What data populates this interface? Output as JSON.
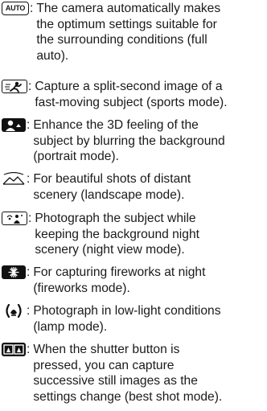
{
  "modes": [
    {
      "icon": "auto-mode-icon",
      "icon_text": "AUTO",
      "lines": [
        "The camera automatically makes",
        "the optimum settings suitable for",
        "the surrounding conditions (full",
        "auto)."
      ]
    },
    {
      "icon": "sports-mode-icon",
      "lines": [
        "Capture a split-second image of a",
        "fast-moving subject (sports mode)."
      ]
    },
    {
      "icon": "portrait-mode-icon",
      "lines": [
        "Enhance the 3D feeling of the",
        "subject by blurring the background",
        "(portrait mode)."
      ]
    },
    {
      "icon": "landscape-mode-icon",
      "lines": [
        "For beautiful shots of distant",
        "scenery (landscape mode)."
      ]
    },
    {
      "icon": "night-view-mode-icon",
      "lines": [
        "Photograph the subject while",
        "keeping the background night",
        "scenery (night view mode)."
      ]
    },
    {
      "icon": "fireworks-mode-icon",
      "lines": [
        "For capturing fireworks at night",
        "(fireworks mode)."
      ]
    },
    {
      "icon": "lamp-mode-icon",
      "lines": [
        "Photograph in low-light conditions",
        "(lamp mode)."
      ]
    },
    {
      "icon": "best-shot-mode-icon",
      "lines": [
        "When the shutter button is",
        "pressed, you can capture",
        "successive still images as the",
        "settings change (best shot mode)."
      ]
    }
  ],
  "separator": ":"
}
